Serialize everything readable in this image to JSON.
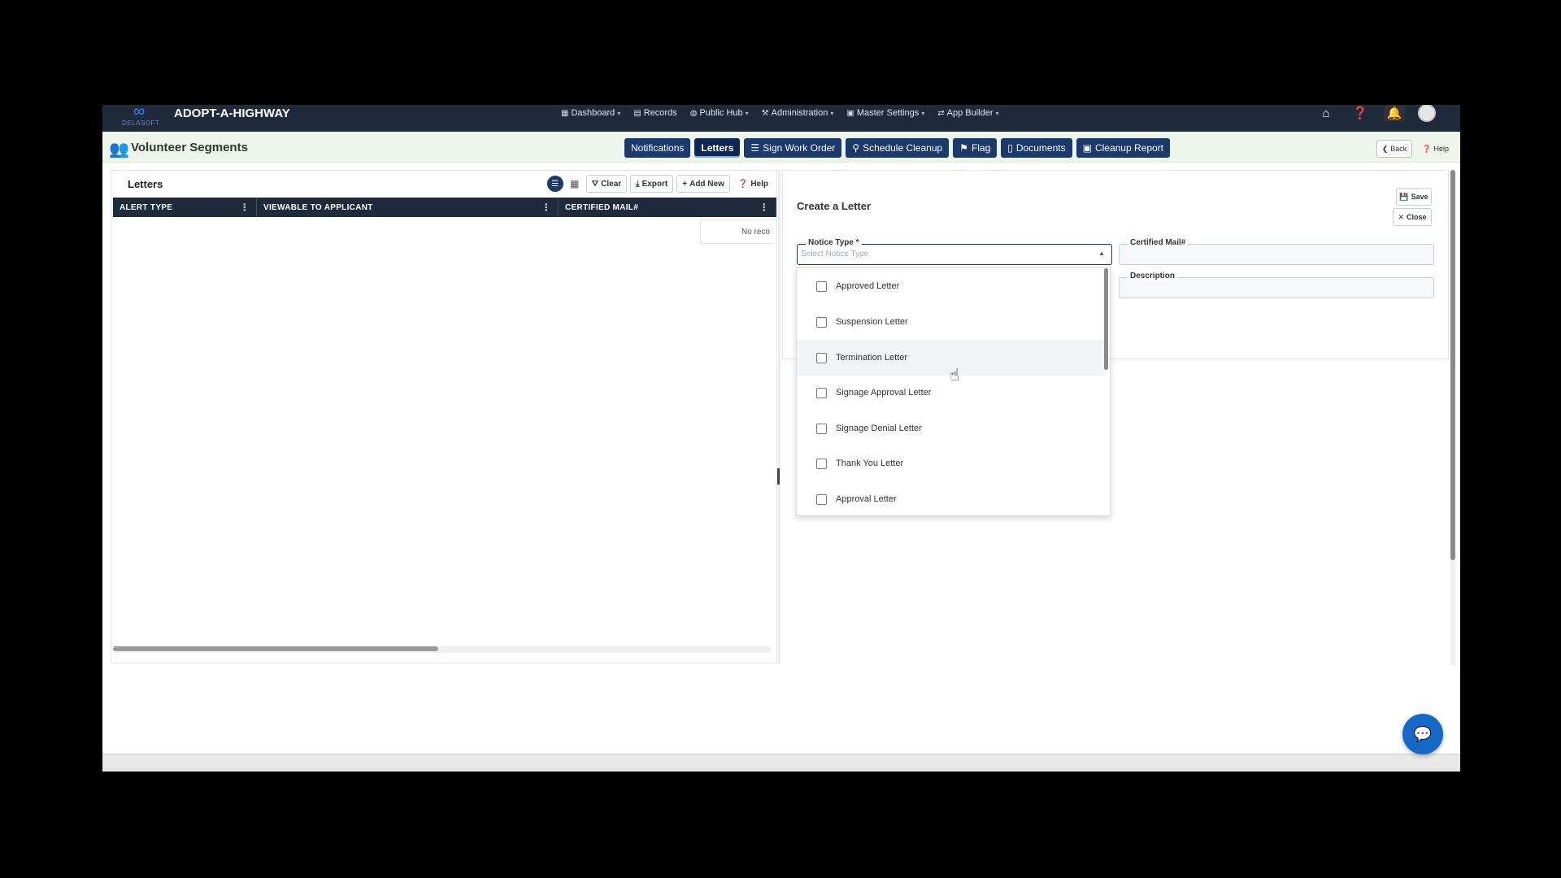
{
  "app": {
    "title": "ADOPT-A-HIGHWAY",
    "logo_text": "DELASOFT"
  },
  "nav": [
    {
      "label": "Dashboard",
      "icon": "dashboard-icon",
      "has_menu": true
    },
    {
      "label": "Records",
      "icon": "records-icon",
      "has_menu": false
    },
    {
      "label": "Public Hub",
      "icon": "globe-icon",
      "has_menu": true
    },
    {
      "label": "Administration",
      "icon": "admin-icon",
      "has_menu": true
    },
    {
      "label": "Master Settings",
      "icon": "settings-icon",
      "has_menu": true
    },
    {
      "label": "App Builder",
      "icon": "builder-icon",
      "has_menu": true
    }
  ],
  "page": {
    "title": "Volunteer Segments"
  },
  "tabs": [
    {
      "label": "Notifications",
      "icon": "",
      "active": false
    },
    {
      "label": "Letters",
      "icon": "",
      "active": true
    },
    {
      "label": "Sign Work Order",
      "icon": "list-icon",
      "active": false
    },
    {
      "label": "Schedule Cleanup",
      "icon": "person-icon",
      "active": false
    },
    {
      "label": "Flag",
      "icon": "flag-icon",
      "active": false
    },
    {
      "label": "Documents",
      "icon": "document-icon",
      "active": false
    },
    {
      "label": "Cleanup Report",
      "icon": "report-icon",
      "active": false
    }
  ],
  "header_buttons": {
    "back": "Back",
    "help": "Help"
  },
  "letters_panel": {
    "title": "Letters",
    "toolbar": {
      "clear": "Clear",
      "export": "Export",
      "add_new": "Add New",
      "help": "Help"
    },
    "columns": [
      "ALERT TYPE",
      "VIEWABLE TO APPLICANT",
      "CERTIFIED MAIL#"
    ],
    "empty_text": "No reco"
  },
  "create_panel": {
    "title": "Create a Letter",
    "save": "Save",
    "close": "Close",
    "notice_type": {
      "label": "Notice Type *",
      "placeholder": "Select Notice Type"
    },
    "certified_mail": {
      "label": "Certified Mail#"
    },
    "description": {
      "label": "Description"
    }
  },
  "dropdown": {
    "options": [
      {
        "label": "Approved Letter",
        "checked": false
      },
      {
        "label": "Suspension Letter",
        "checked": false
      },
      {
        "label": "Termination Letter",
        "checked": false,
        "hovered": true
      },
      {
        "label": "Signage Approval Letter",
        "checked": false
      },
      {
        "label": "Signage Denial Letter",
        "checked": false
      },
      {
        "label": "Thank You Letter",
        "checked": false
      },
      {
        "label": "Approval Letter",
        "checked": false
      }
    ]
  }
}
